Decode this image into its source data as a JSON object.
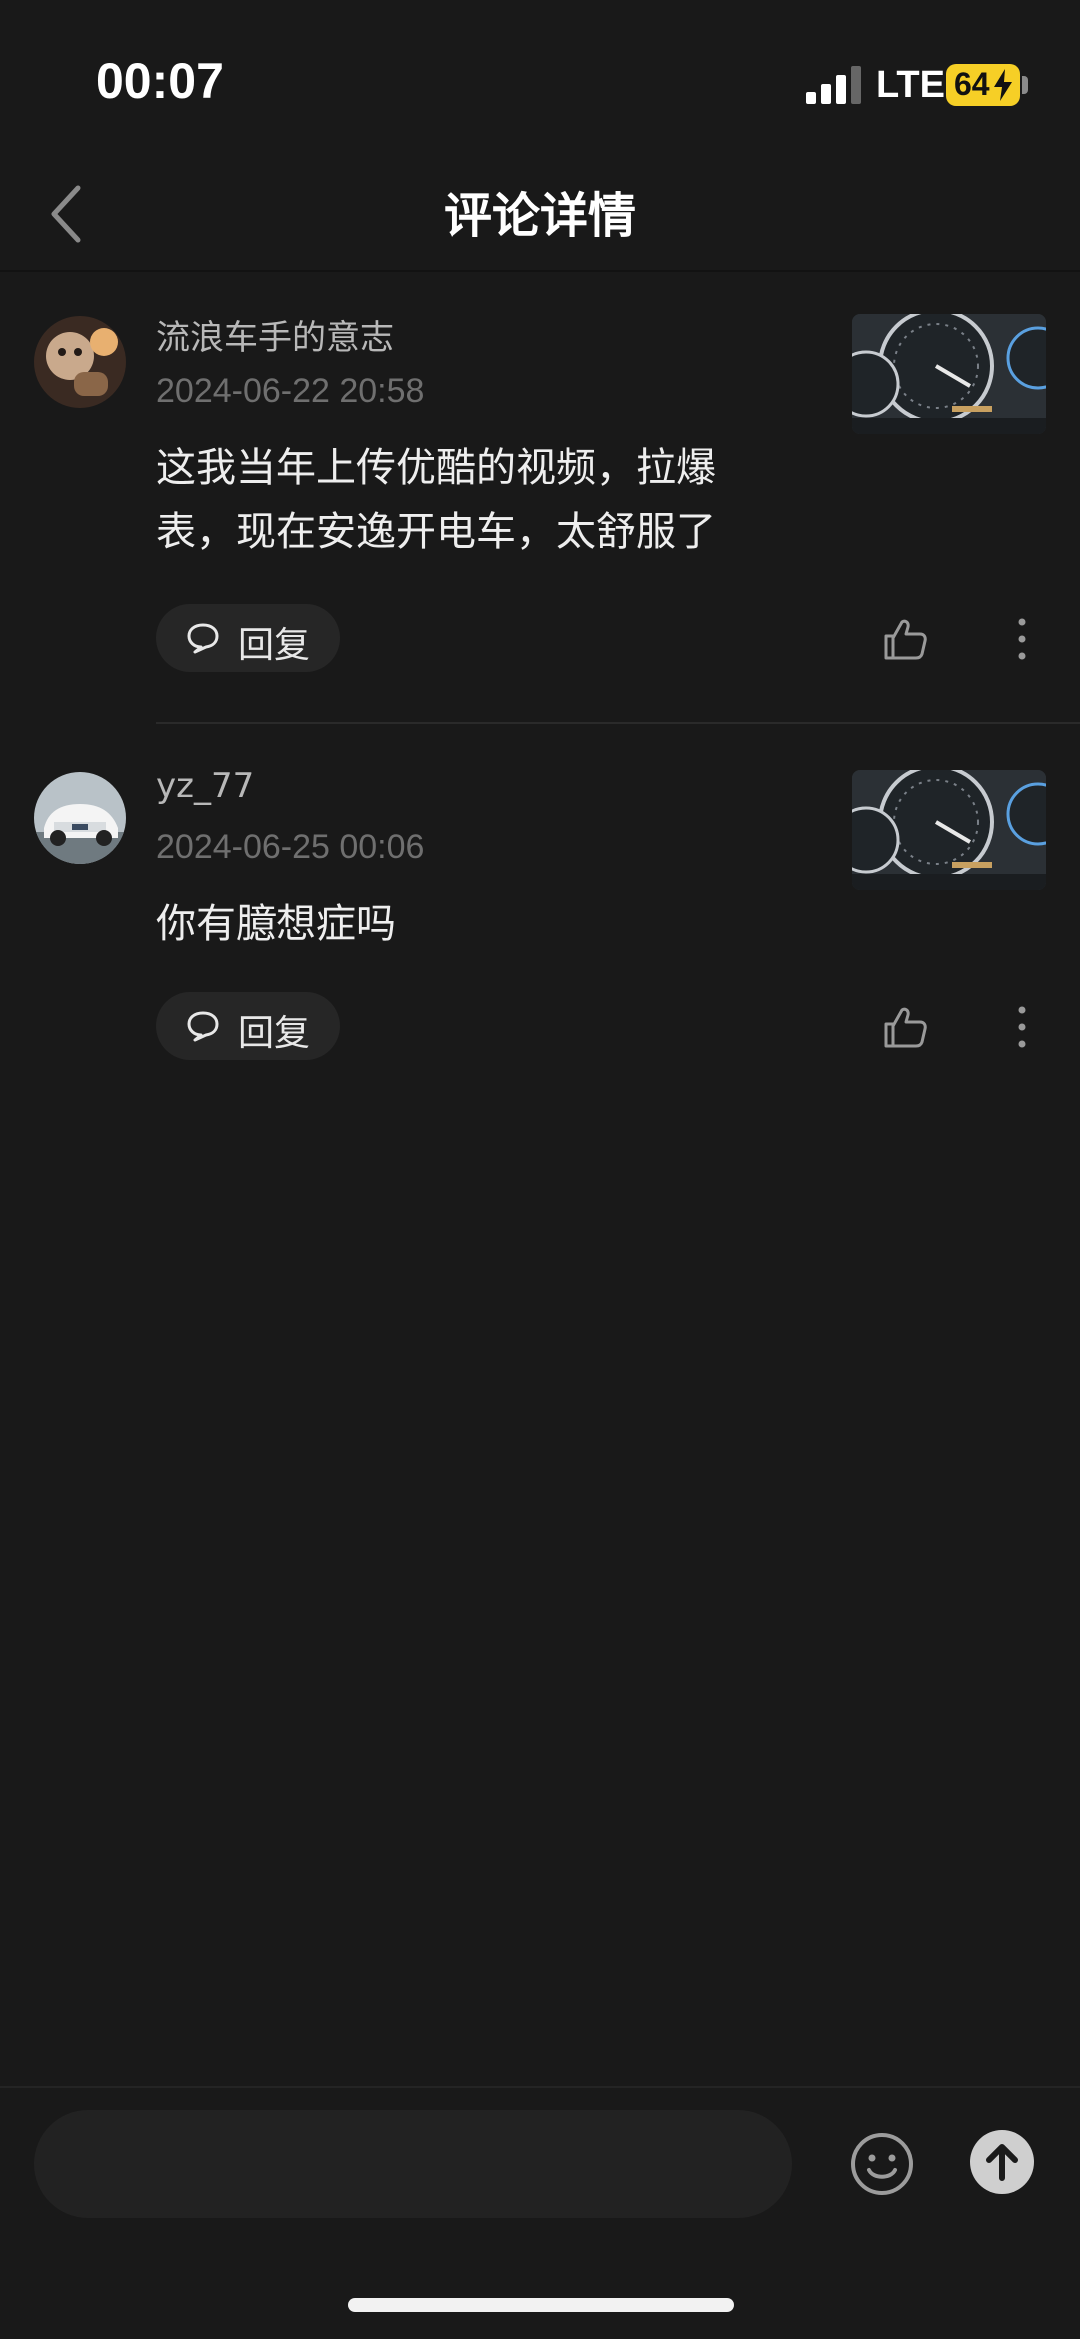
{
  "status_bar": {
    "time": "00:07",
    "network": "LTE",
    "battery": "64"
  },
  "header": {
    "title": "评论详情"
  },
  "comments": [
    {
      "username": "流浪车手的意志",
      "timestamp": "2024-06-22 20:58",
      "text_lines": [
        "这我当年上传优酷的视频，拉爆",
        "表，现在安逸开电车，太舒服了"
      ],
      "reply_label": "回复"
    },
    {
      "username": "yz_77",
      "timestamp": "2024-06-25 00:06",
      "text_lines": [
        "你有臆想症吗"
      ],
      "reply_label": "回复"
    }
  ],
  "input": {
    "placeholder": ""
  },
  "colors": {
    "background": "#191919",
    "battery": "#f6cf26",
    "send": "#cfcfcf"
  },
  "icons": [
    "back-chevron-icon",
    "comment-bubble-icon",
    "thumbs-up-icon",
    "more-vertical-icon",
    "emoji-icon",
    "send-arrow-up-icon"
  ]
}
